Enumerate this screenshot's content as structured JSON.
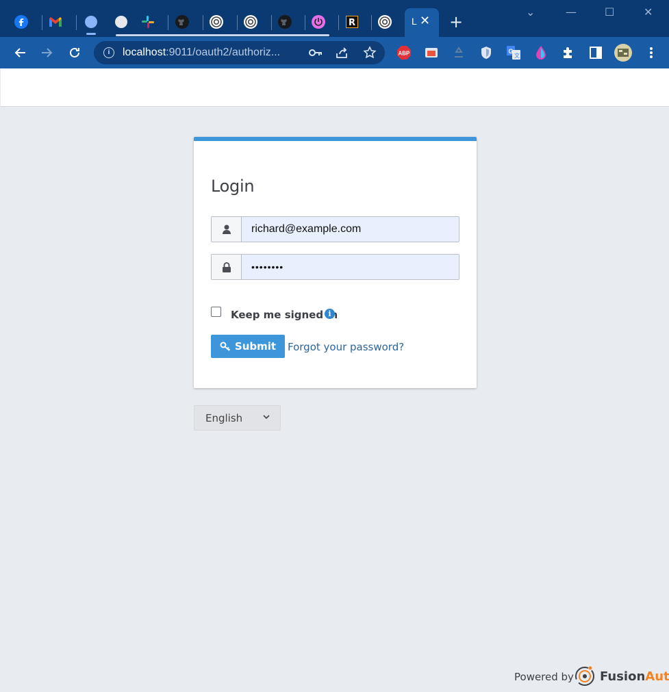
{
  "browser": {
    "tabs": [
      {
        "icon": "facebook-icon"
      },
      {
        "icon": "gmail-icon"
      },
      {
        "icon": "blue-dot-icon"
      },
      {
        "icon": "gray-dot-icon"
      },
      {
        "icon": "slack-icon"
      },
      {
        "icon": "github-icon"
      },
      {
        "icon": "fusionauth-icon"
      },
      {
        "icon": "fusionauth-icon"
      },
      {
        "icon": "github-icon"
      },
      {
        "icon": "power-icon"
      },
      {
        "icon": "r-icon"
      },
      {
        "icon": "fusionauth-icon"
      }
    ],
    "active_tab": {
      "label": "L",
      "close": "✕"
    },
    "new_tab": "+",
    "address": {
      "host": "localhost",
      "rest": ":9011/oauth2/authoriz..."
    },
    "extensions": [
      "abp-icon",
      "screencast-icon",
      "recycle-icon",
      "shield-icon",
      "translate-icon",
      "drop-icon",
      "puzzle-icon",
      "sidepanel-icon",
      "profile-avatar",
      "menu-icon"
    ],
    "abp_label": "ABP"
  },
  "login": {
    "title": "Login",
    "email_value": "richard@example.com",
    "password_value": "••••••••",
    "remember_label": "Keep me signed in",
    "submit_label": "Submit",
    "forgot_label": "Forgot your password?",
    "info_glyph": "i"
  },
  "language": {
    "selected": "English"
  },
  "footer": {
    "powered_by": "Powered by",
    "brand_fusion": "Fusion",
    "brand_auth": "Auth"
  },
  "colors": {
    "accent": "#3c96d9",
    "chrome": "#1a5ba6",
    "tabstrip": "#0b3a73",
    "autofill": "#e8f0fe",
    "brand_orange": "#f58320"
  }
}
